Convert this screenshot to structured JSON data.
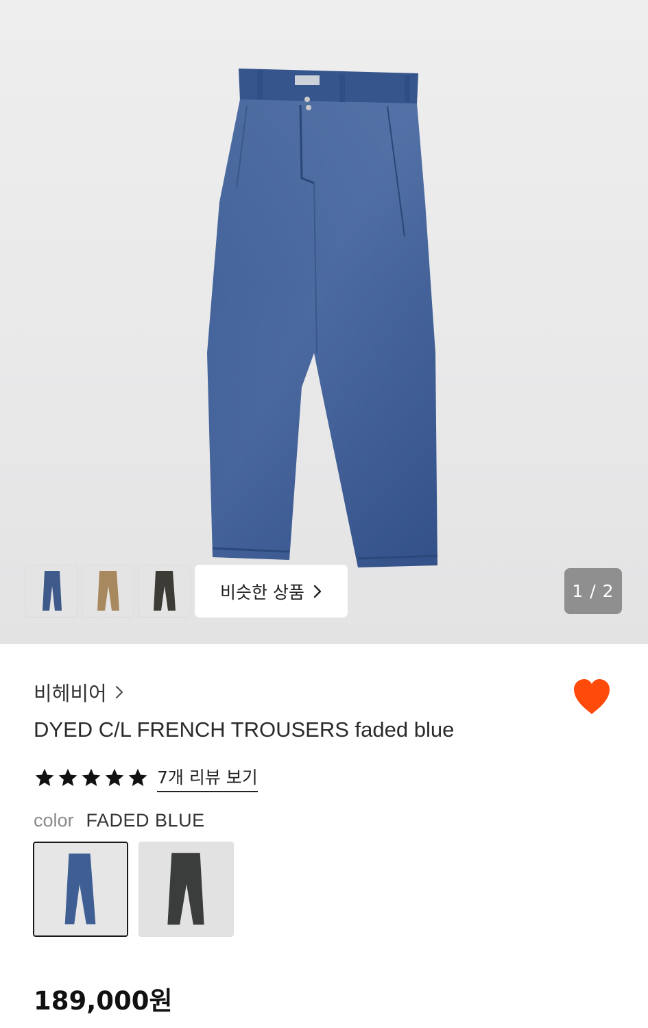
{
  "gallery": {
    "main_image_icon": "faded-blue-trousers-photo",
    "thumbnails": [
      {
        "icon": "blue-trousers-thumbnail",
        "color": "#3d5a8a"
      },
      {
        "icon": "beige-trousers-thumbnail",
        "color": "#a8895f"
      },
      {
        "icon": "dark-trousers-thumbnail",
        "color": "#3d3b35"
      }
    ],
    "similar_button_label": "비슷한 상품",
    "counter": "1 / 2"
  },
  "product": {
    "brand": "비헤비어",
    "title": "DYED C/L FRENCH TROUSERS faded blue",
    "rating": 5,
    "review_link": "7개 리뷰 보기",
    "color_label": "color",
    "color_value": "FADED BLUE",
    "color_options": [
      {
        "icon": "faded-blue-swatch",
        "selected": true
      },
      {
        "icon": "charcoal-swatch",
        "selected": false
      }
    ],
    "price": "189,000원",
    "favorite": true
  },
  "colors": {
    "heart": "#ff4a0a",
    "trouser_blue": "#3f5f94",
    "counter_bg": "#8f8f8f"
  }
}
